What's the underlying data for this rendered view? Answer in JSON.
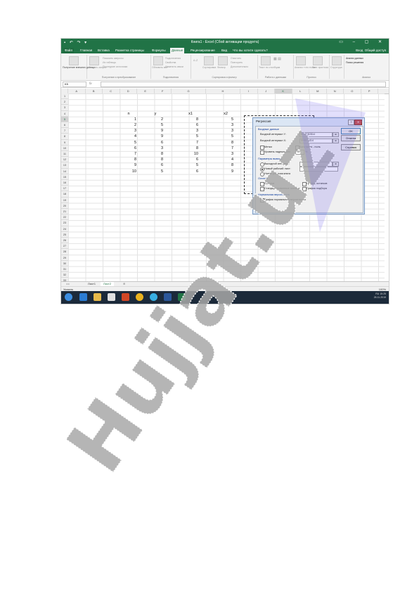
{
  "window": {
    "title": "Книга1 - Excel (Сбой активации продукта)"
  },
  "tabs": [
    "Файл",
    "Главная",
    "Вставка",
    "Разметка страницы",
    "Формулы",
    "Данные",
    "Рецензирование",
    "Вид",
    "Что вы хотите сделать?"
  ],
  "user": {
    "login": "Вход",
    "share": "Общий доступ"
  },
  "ribbon": {
    "groups": [
      "Получение и преобразование",
      "Подключения",
      "Сортировка и фильтр",
      "Работа с данными",
      "Прогноз",
      "Структура",
      "Анализ"
    ],
    "items": {
      "get_data": "Получение внешних данных",
      "create_query": "Создать запрос",
      "show_queries": "Показать запросы",
      "from_table": "Из таблицы",
      "recent_sources": "Последние источники",
      "refresh_all": "Обновить все",
      "connections": "Подключения",
      "properties": "Свойства",
      "edit_links": "Изменить связи",
      "sort": "Сортировка",
      "filter": "Фильтр",
      "clear": "Очистить",
      "reapply": "Повторить",
      "advanced": "Дополнительно",
      "text_to_columns": "Текст по столбцам",
      "what_if": "Анализ «что если»",
      "forecast_sheet": "Лист прогноза",
      "outline": "Структура",
      "data_analysis": "Анализ данных",
      "solver": "Поиск решения"
    }
  },
  "formula_bar": {
    "name_box": "K5",
    "fx": "fx"
  },
  "columns": [
    "A",
    "B",
    "C",
    "D",
    "E",
    "F",
    "G",
    "H",
    "I",
    "J",
    "K",
    "L",
    "M",
    "N",
    "O",
    "P",
    "Q",
    "R"
  ],
  "rows": [
    "1",
    "2",
    "3",
    "4",
    "5",
    "6",
    "7",
    "8",
    "9",
    "10",
    "11",
    "12",
    "13",
    "14",
    "15",
    "16",
    "17",
    "18",
    "19",
    "20",
    "21",
    "22",
    "23",
    "24",
    "25",
    "26",
    "27",
    "28",
    "29",
    "30",
    "31",
    "32",
    "33"
  ],
  "table": {
    "headers": [
      "n",
      "y",
      "x1",
      "x2"
    ],
    "rows": [
      [
        "1",
        "2",
        "8",
        "5"
      ],
      [
        "2",
        "5",
        "6",
        "3"
      ],
      [
        "3",
        "9",
        "3",
        "3"
      ],
      [
        "4",
        "9",
        "5",
        "5"
      ],
      [
        "5",
        "6",
        "7",
        "8"
      ],
      [
        "6",
        "3",
        "8",
        "7"
      ],
      [
        "7",
        "8",
        "10",
        "3"
      ],
      [
        "8",
        "8",
        "6",
        "4"
      ],
      [
        "9",
        "6",
        "5",
        "8"
      ],
      [
        "10",
        "5",
        "6",
        "9"
      ]
    ]
  },
  "dialog": {
    "title": "Регрессия",
    "input_section": "Входные данные",
    "input_y_label": "Входной интервал Y:",
    "input_y_value": "$G$5:$G$14",
    "input_x_label": "Входной интервал X:",
    "input_x_value": "$H$5:$I$14",
    "labels": "Метки",
    "constant_zero": "Константа - ноль",
    "confidence": "Уровень надежности",
    "confidence_value": "95",
    "percent": "%",
    "output_section": "Параметры вывода",
    "output_range": "Выходной интервал:",
    "new_sheet": "Новый рабочий лист:",
    "new_book": "Новая рабочая книга",
    "residuals_section": "Остатки",
    "residuals": "Остатки",
    "std_residuals": "Стандартизованные остатки",
    "residual_plots": "График остатков",
    "line_fit": "График подбора",
    "normal_section": "Нормальная вероятность",
    "normal_plot": "График нормальной вероятности",
    "ok": "OK",
    "cancel": "Отмена",
    "help": "Справка",
    "help_btn": "?",
    "close_btn": "✕"
  },
  "sheets": [
    "Лист1",
    "Лист2"
  ],
  "active_sheet": "Лист2",
  "status": {
    "left": "Указать",
    "zoom": "100%"
  },
  "tray": {
    "lang": "RU",
    "time": "15:25",
    "date": "26.11.2019"
  },
  "watermark": "Hujjat.uz"
}
